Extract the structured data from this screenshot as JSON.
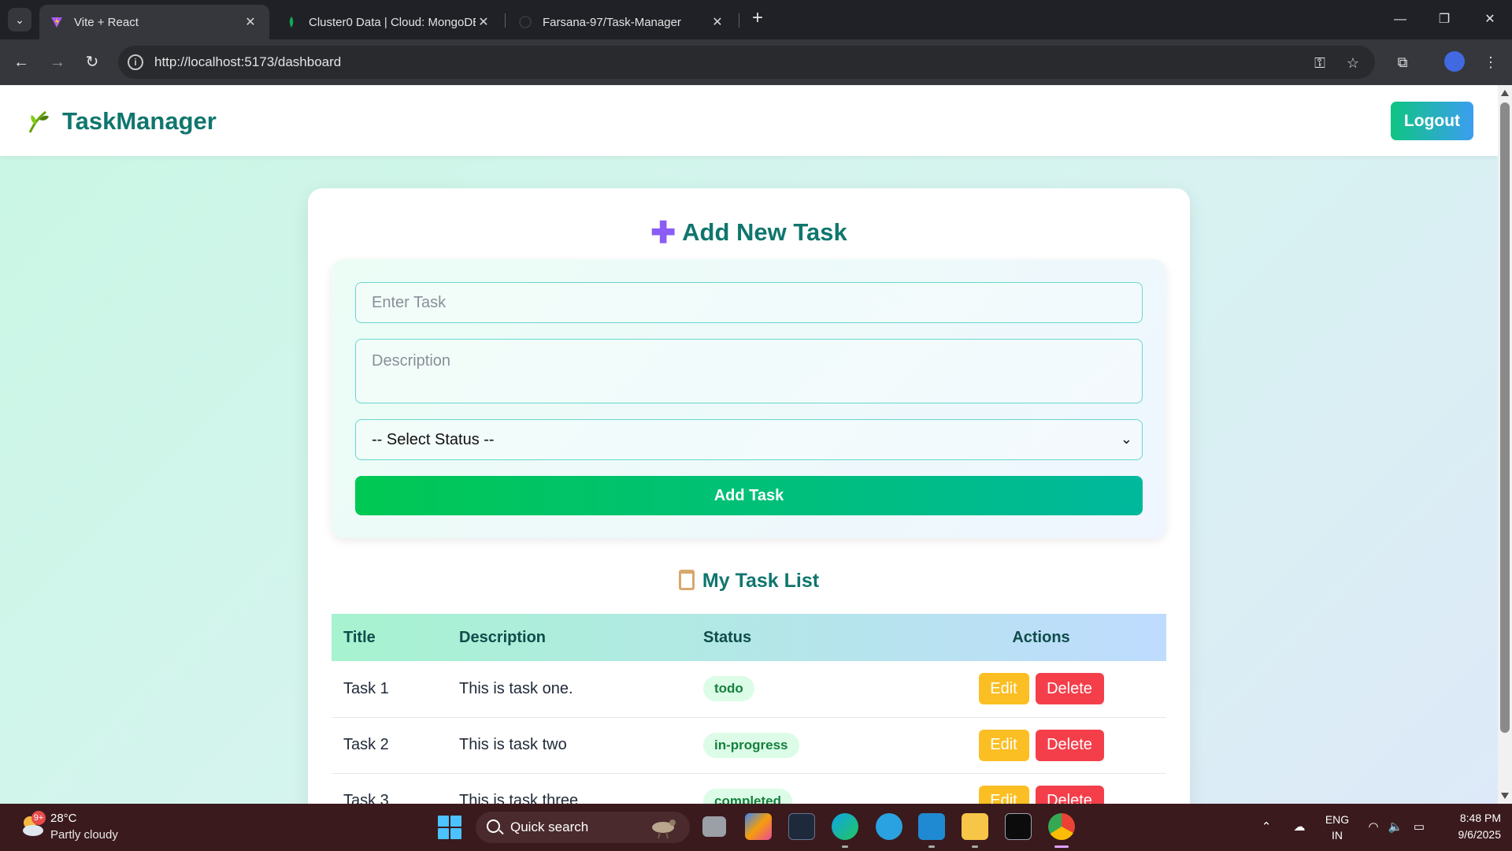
{
  "browser": {
    "tabs": [
      {
        "title": "Vite + React",
        "active": true
      },
      {
        "title": "Cluster0 Data | Cloud: MongoDB",
        "active": false
      },
      {
        "title": "Farsana-97/Task-Manager",
        "active": false
      }
    ],
    "url": "http://localhost:5173/dashboard"
  },
  "app": {
    "brand": "TaskManager",
    "logout_label": "Logout",
    "form": {
      "title": "Add New Task",
      "task_placeholder": "Enter Task",
      "description_placeholder": "Description",
      "status_selected": "-- Select Status --",
      "submit_label": "Add Task"
    },
    "list": {
      "title": "My Task List",
      "columns": [
        "Title",
        "Description",
        "Status",
        "Actions"
      ],
      "rows": [
        {
          "title": "Task 1",
          "description": "This is task one.",
          "status": "todo"
        },
        {
          "title": "Task 2",
          "description": "This is task two",
          "status": "in-progress"
        },
        {
          "title": "Task 3",
          "description": "This is task three",
          "status": "completed"
        }
      ],
      "edit_label": "Edit",
      "delete_label": "Delete"
    }
  },
  "taskbar": {
    "weather_badge": "9+",
    "temperature": "28°C",
    "weather": "Partly cloudy",
    "search_label": "Quick search",
    "language": "ENG",
    "region": "IN",
    "time": "8:48 PM",
    "date": "9/6/2025"
  },
  "colors": {
    "brand": "#0f766e",
    "add_button_start": "#00c853",
    "add_button_end": "#00b89c",
    "edit": "#fbbf24",
    "delete": "#f43f4b",
    "taskbar": "#3a1a1d"
  }
}
